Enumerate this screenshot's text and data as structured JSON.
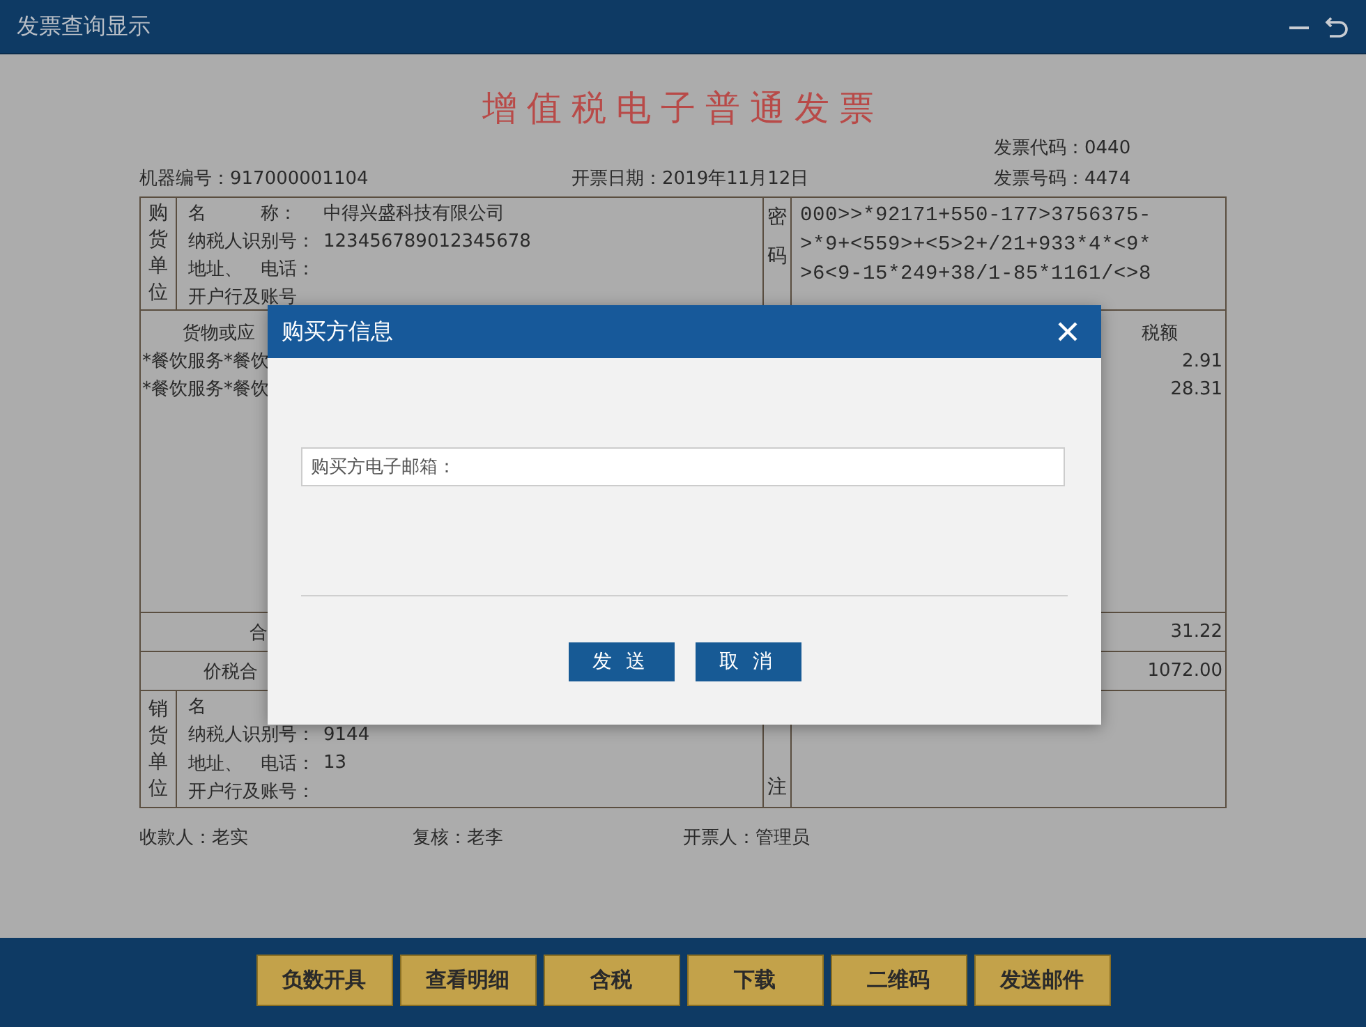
{
  "window": {
    "title": "发票查询显示"
  },
  "invoice": {
    "title": "增值税电子普通发票",
    "header": [
      {
        "label": "机器编号：",
        "value": "917000001104"
      },
      {
        "label": "开票日期：",
        "value": "2019年11月12日"
      }
    ],
    "codes": [
      {
        "label": "发票代码：",
        "value": "0440"
      },
      {
        "label": "发票号码：",
        "value": "4474"
      }
    ],
    "buyer": {
      "section_label": "购货单位",
      "fields": [
        {
          "label": "名　　　称：",
          "value": "中得兴盛科技有限公司"
        },
        {
          "label": "纳税人识别号：",
          "value": "123456789012345678"
        },
        {
          "label": "地址、　电话："
        },
        {
          "label": "开户行及账号"
        }
      ],
      "cipher_label": "密码",
      "cipher_lines": [
        "000>>*92171+550-177>3756375-",
        ">*9+<559>+<5>2+/21+933*4*<9*",
        ">6<9-15*249+38/1-85*1161/<>8"
      ]
    },
    "items": {
      "column_1": "货物或应",
      "column_2": "税额",
      "rows": [
        {
          "name": "*餐饮服务*餐饮",
          "tax": "2.91"
        },
        {
          "name": "*餐饮服务*餐饮",
          "tax": "28.31"
        }
      ]
    },
    "total": {
      "label": "合",
      "tax": "31.22"
    },
    "grand_total": {
      "label": "价税合",
      "amount": "1072.00"
    },
    "seller": {
      "section_label": "销货单位",
      "fields": [
        {
          "label": "名"
        },
        {
          "label": "纳税人识别号：",
          "value": "9144"
        },
        {
          "label": "地址、　电话：",
          "value": "13"
        },
        {
          "label": "开户行及账号："
        }
      ],
      "remarks_label": "注"
    },
    "signatures": [
      {
        "label": "收款人：",
        "value": "老实"
      },
      {
        "label": "复核：",
        "value": "老李"
      },
      {
        "label": "开票人：",
        "value": "管理员"
      }
    ]
  },
  "dialog": {
    "title": "购买方信息",
    "email_field": {
      "placeholder": "购买方电子邮箱："
    },
    "buttons": [
      "发 送",
      "取 消"
    ]
  },
  "toolbar": [
    "负数开具",
    "查看明细",
    "含税",
    "下载",
    "二维码",
    "发送邮件"
  ]
}
